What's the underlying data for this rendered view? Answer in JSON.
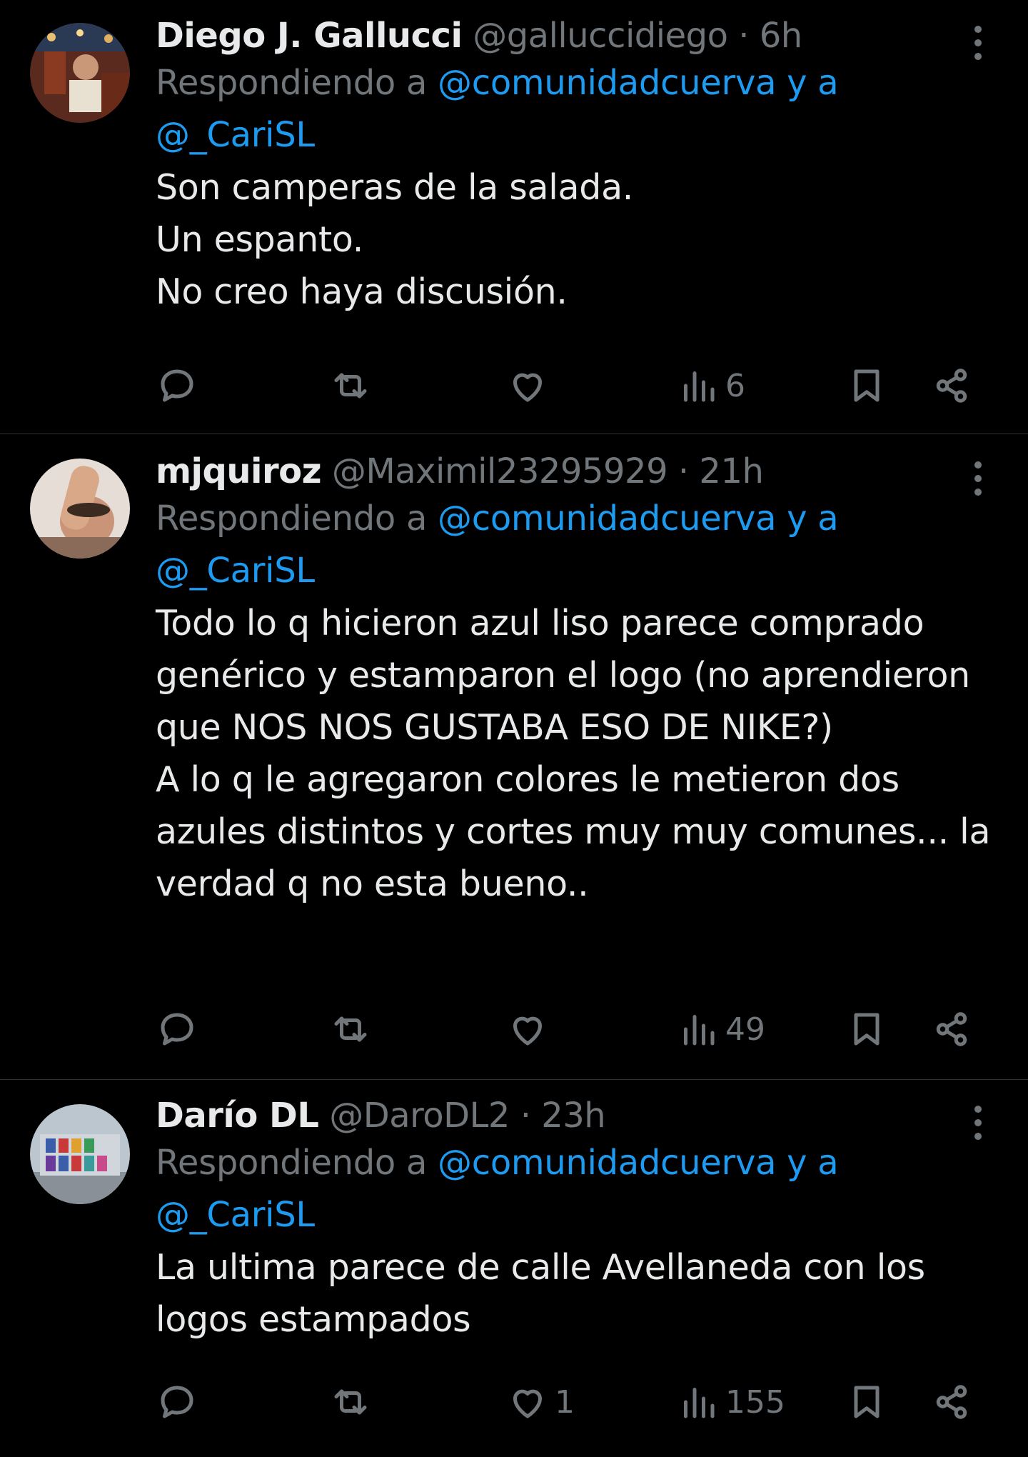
{
  "tweets": [
    {
      "name": "Diego J. Gallucci",
      "handle": "@galluccidiego",
      "sep": "·",
      "time": "6h",
      "replying_prefix": "Respondiendo a",
      "replying_mentions": "@comunidadcuerva y a @_CariSL",
      "text": "Son camperas de la salada.\nUn espanto.\nNo creo haya discusión.",
      "likes": "",
      "views": "6"
    },
    {
      "name": "mjquiroz",
      "handle": "@Maximil23295929",
      "sep": "·",
      "time": "21h",
      "replying_prefix": "Respondiendo a",
      "replying_mentions": "@comunidadcuerva y a @_CariSL",
      "text": "Todo lo q hicieron azul liso parece comprado genérico y estamparon el logo (no aprendieron que NOS NOS GUSTABA ESO DE NIKE?)\nA lo q le agregaron colores le metieron dos azules distintos y cortes muy muy comunes... la verdad q no esta bueno..",
      "likes": "",
      "views": "49"
    },
    {
      "name": "Darío DL",
      "handle": "@DaroDL2",
      "sep": "·",
      "time": "23h",
      "replying_prefix": "Respondiendo a",
      "replying_mentions": "@comunidadcuerva y a @_CariSL",
      "text": "La ultima parece de calle Avellaneda con los logos estampados",
      "likes": "1",
      "views": "155"
    }
  ],
  "icons": [
    "reply-icon",
    "retweet-icon",
    "like-icon",
    "views-icon",
    "bookmark-icon",
    "share-icon",
    "more-icon"
  ],
  "colors": {
    "background": "#000000",
    "text": "#e7e9ea",
    "muted": "#71767b",
    "link": "#1d9bf0",
    "divider": "#2f3336"
  }
}
